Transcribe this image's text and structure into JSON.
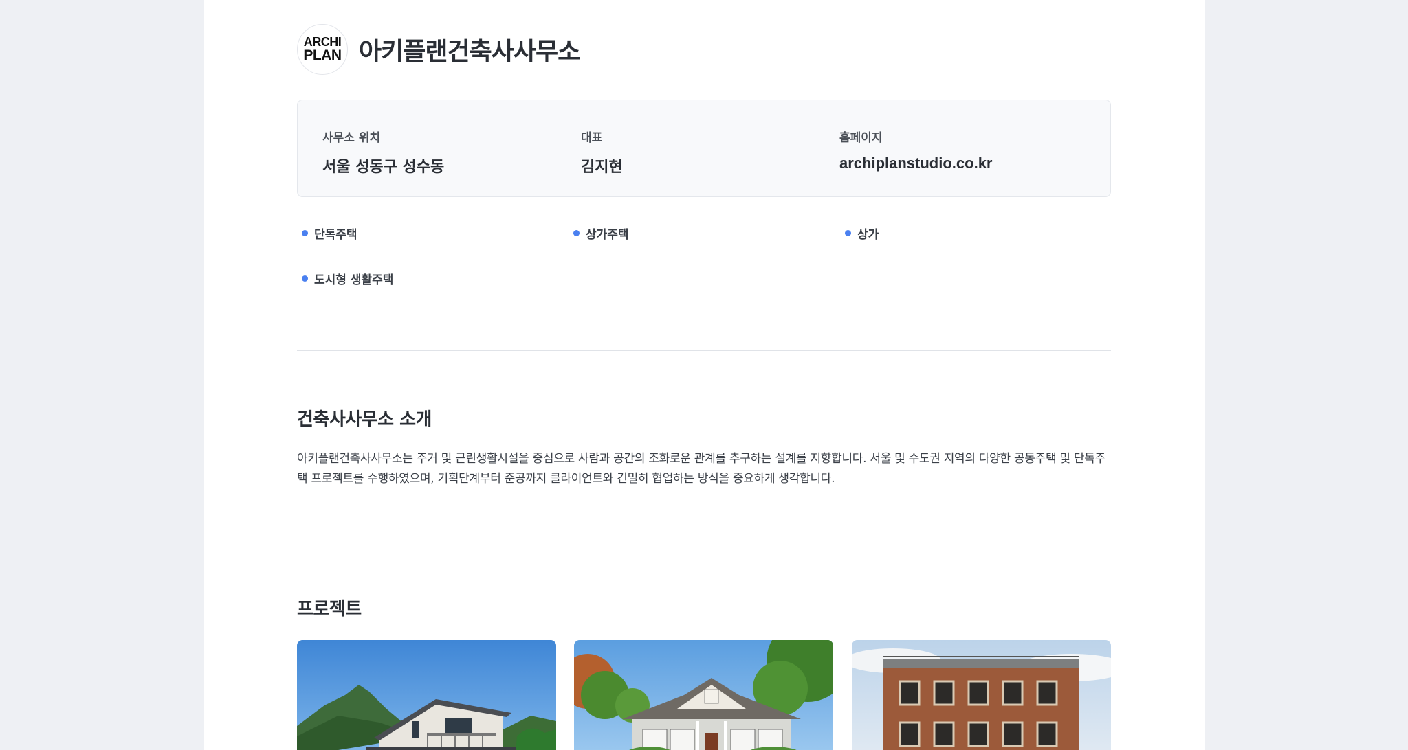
{
  "office": {
    "logo_line1": "ARCHI",
    "logo_line2": "PLAN",
    "name": "아키플랜건축사사무소"
  },
  "info": {
    "location_label": "사무소 위치",
    "location_value": "서울 성동구 성수동",
    "ceo_label": "대표",
    "ceo_value": "김지현",
    "homepage_label": "홈페이지",
    "homepage_value": "archiplanstudio.co.kr"
  },
  "tags": [
    "단독주택",
    "상가주택",
    "상가",
    "도시형 생활주택"
  ],
  "intro": {
    "title": "건축사사무소 소개",
    "text": "아키플랜건축사사무소는 주거 및 근린생활시설을 중심으로 사람과 공간의 조화로운 관계를 추구하는 설계를 지향합니다. 서울 및 수도권 지역의 다양한 공동주택 및 단독주택 프로젝트를 수행하였으며, 기획단계부터 준공까지 클라이언트와 긴밀히 협업하는 방식을 중요하게 생각합니다."
  },
  "projects": {
    "title": "프로젝트",
    "items": [
      {
        "image": "modern-house-with-mountain-photo"
      },
      {
        "image": "suburban-house-with-trees-photo"
      },
      {
        "image": "brick-building-photo"
      }
    ]
  },
  "colors": {
    "page_bg": "#eef0f4",
    "tag_dot": "#4a80f0",
    "card_bg": "#f8f9fb"
  }
}
